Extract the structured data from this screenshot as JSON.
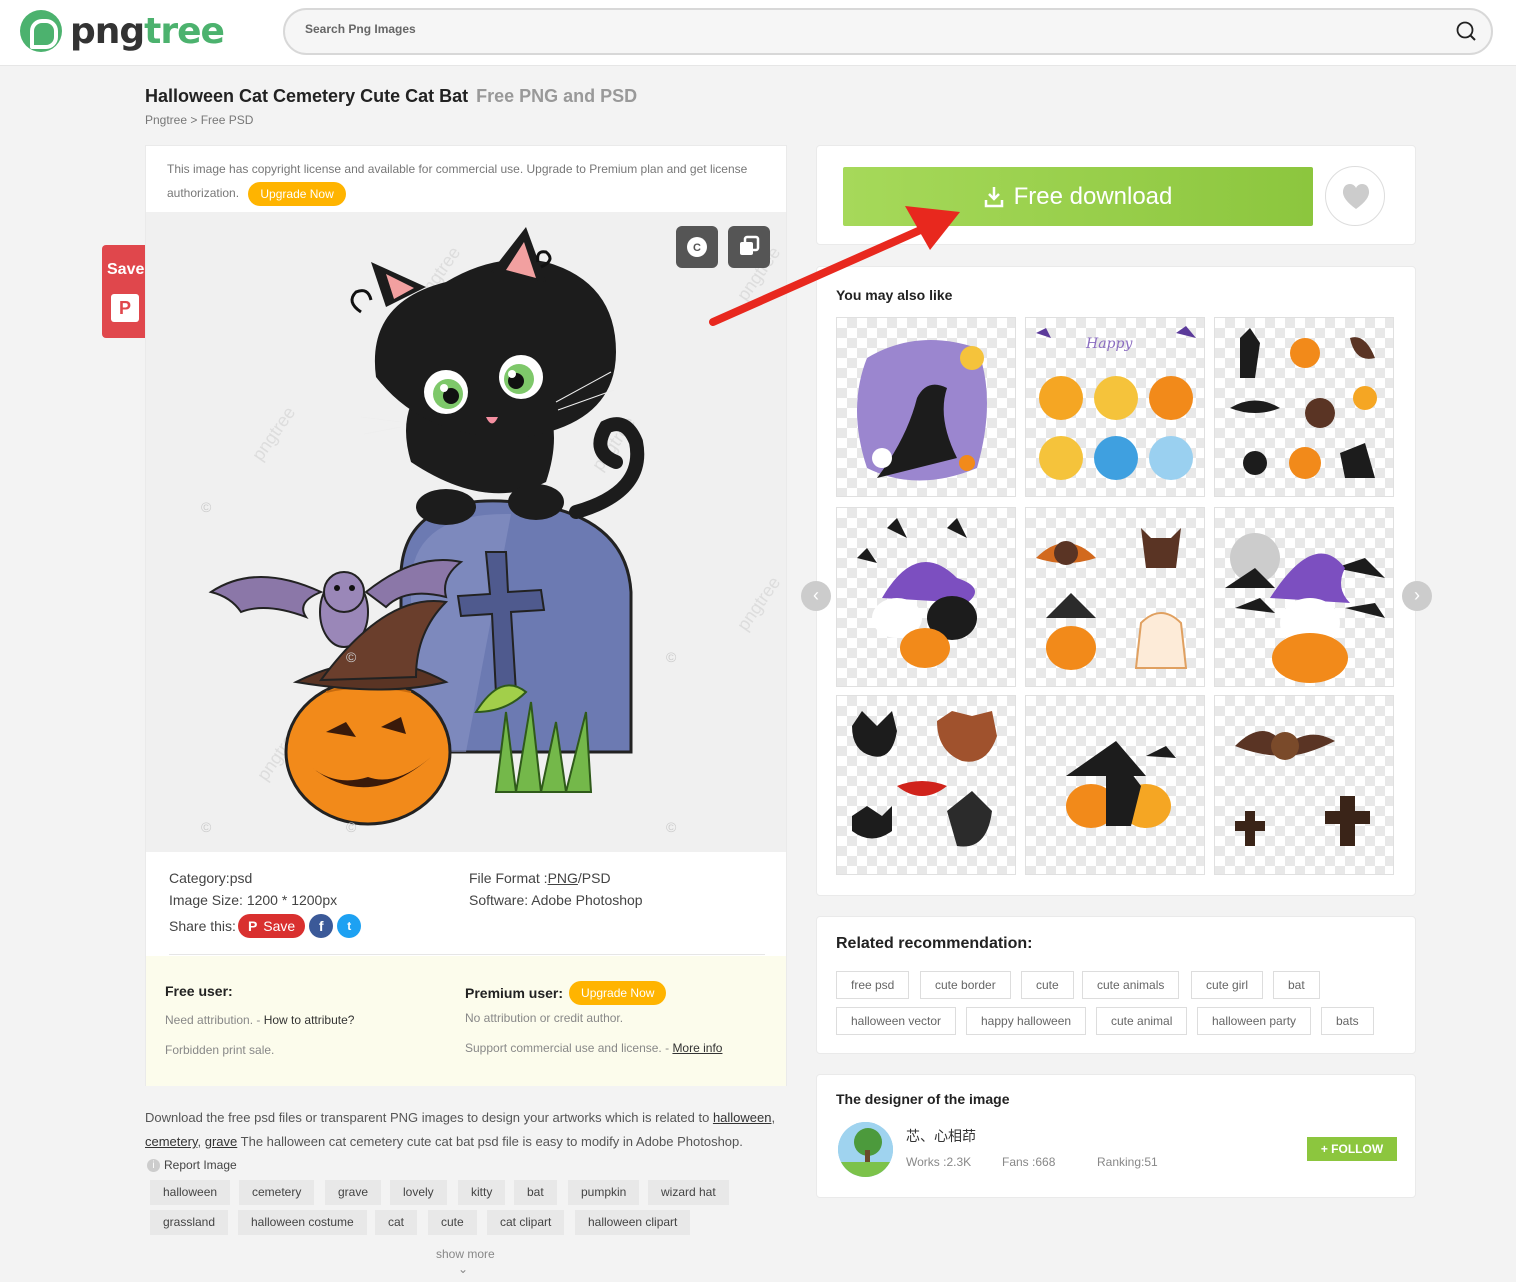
{
  "header": {
    "logo_prefix": "png",
    "logo_suffix": "tree",
    "search_placeholder": "Search Png Images"
  },
  "page": {
    "title": "Halloween Cat Cemetery Cute Cat Bat",
    "title_sub": "Free PNG and PSD",
    "breadcrumb": "Pngtree > Free PSD"
  },
  "side_save": {
    "label": "Save",
    "pin_icon": "P"
  },
  "license": {
    "text": "This image has copyright license and available for commercial use. Upgrade to Premium plan and get license authorization.",
    "upgrade_label": "Upgrade Now"
  },
  "preview": {
    "watermark": "pngtree",
    "copyright_btn": "C"
  },
  "info": {
    "category_label": "Category:",
    "category_value": "psd",
    "size_label": "Image Size:",
    "size_value": "1200 * 1200px",
    "share_label": "Share this:",
    "share_save": "Save",
    "format_label": "File Format :",
    "format_png": "PNG",
    "format_rest": "/PSD",
    "software_label": "Software:",
    "software_value": "Adobe Photoshop"
  },
  "users": {
    "free_title": "Free user:",
    "free_line1_a": "Need attribution. - ",
    "free_line1_b": "How to attribute?",
    "free_line2": "Forbidden print sale.",
    "premium_title": "Premium user:",
    "premium_upgrade": "Upgrade Now",
    "premium_line1": "No attribution or credit author.",
    "premium_line2_a": "Support commercial use and license. - ",
    "premium_line2_b": "More info"
  },
  "description": {
    "text_a": "Download the free psd files or transparent PNG images to design your artworks which is related to ",
    "link1": "halloween",
    "sep1": ",",
    "link2": "cemetery",
    "sep2": ", ",
    "link3": "grave",
    "text_b": " The halloween cat cemetery cute cat bat psd file is easy to modify in Adobe Photoshop."
  },
  "report_label": "Report Image",
  "tags_row1": [
    "halloween",
    "cemetery",
    "grave",
    "lovely",
    "kitty",
    "bat",
    "pumpkin",
    "wizard hat"
  ],
  "tags_row2": [
    "grassland",
    "halloween costume",
    "cat",
    "cute",
    "cat clipart",
    "halloween clipart"
  ],
  "show_more": "show more",
  "download": {
    "label": "Free download"
  },
  "also_like": {
    "title": "You may also like"
  },
  "related": {
    "title": "Related recommendation:",
    "row1": [
      "free psd",
      "cute border",
      "cute",
      "cute animals",
      "cute girl",
      "bat"
    ],
    "row2": [
      "halloween vector",
      "happy halloween",
      "cute animal",
      "halloween party",
      "bats"
    ]
  },
  "designer": {
    "title": "The designer of the image",
    "name": "芯、心相茚",
    "works": "Works :2.3K",
    "fans": "Fans :668",
    "ranking": "Ranking:51",
    "follow": "+ FOLLOW"
  },
  "colors": {
    "brand_green": "#4cb26e",
    "download_green": "#8cc63e",
    "upgrade_orange": "#ffb400",
    "pinterest_red": "#e0474c",
    "arrow_red": "#e8281e"
  }
}
